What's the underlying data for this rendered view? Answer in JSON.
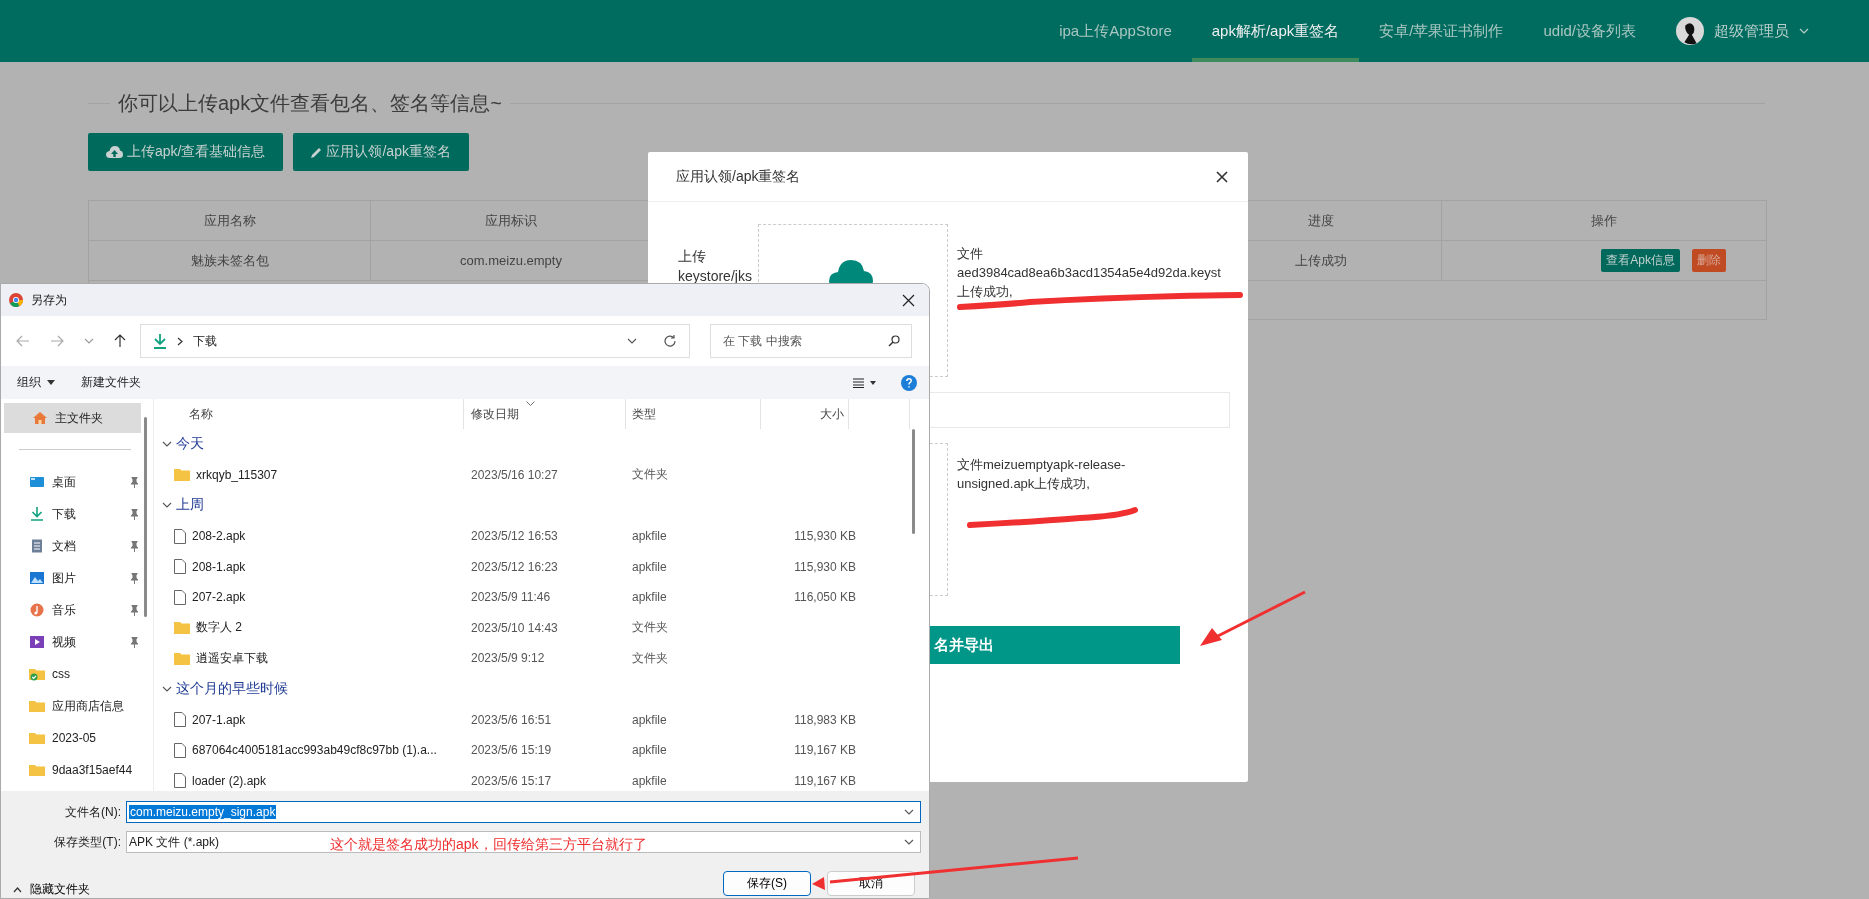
{
  "nav": {
    "items": [
      {
        "label": "ipa上传AppStore",
        "selected": false
      },
      {
        "label": "apk解析/apk重签名",
        "selected": true
      },
      {
        "label": "安卓/苹果证书制作",
        "selected": false
      },
      {
        "label": "udid/设备列表",
        "selected": false
      }
    ],
    "user": "超级管理员"
  },
  "page": {
    "heading": "你可以上传apk文件查看包名、签名等信息~",
    "buttons": [
      {
        "label": "上传apk/查看基础信息"
      },
      {
        "label": "应用认领/apk重签名"
      }
    ],
    "table": {
      "columns": [
        "应用名称",
        "应用标识",
        "进度",
        "操作"
      ],
      "rows": [
        {
          "name": "魅族未签名包",
          "id": "com.meizu.empty",
          "progress": "上传成功",
          "actions": [
            {
              "label": "查看Apk信息",
              "kind": "primary"
            },
            {
              "label": "删除",
              "kind": "danger"
            }
          ]
        }
      ]
    }
  },
  "modal": {
    "title": "应用认领/apk重签名",
    "upload_label": "上传 keystore/jks",
    "uploads": [
      {
        "message": "文件 aed3984cad8ea6b3acd1354a5e4d92da.keyst 上传成功,"
      },
      {
        "message": "文件meizuemptyapk-release-unsigned.apk上传成功,"
      }
    ],
    "submit": "名并导出"
  },
  "save_dialog": {
    "title": "另存为",
    "path": "下载",
    "search_placeholder": "在 下载 中搜索",
    "toolbar": [
      "组织",
      "新建文件夹"
    ],
    "nav_pane": [
      {
        "label": "主文件夹",
        "kind": "home",
        "selected": true,
        "pinned": false
      },
      {
        "label": "桌面",
        "kind": "desktop",
        "selected": false,
        "pinned": true
      },
      {
        "label": "下载",
        "kind": "download",
        "selected": false,
        "pinned": true
      },
      {
        "label": "文档",
        "kind": "document",
        "selected": false,
        "pinned": true
      },
      {
        "label": "图片",
        "kind": "picture",
        "selected": false,
        "pinned": true
      },
      {
        "label": "音乐",
        "kind": "music",
        "selected": false,
        "pinned": true
      },
      {
        "label": "视频",
        "kind": "video",
        "selected": false,
        "pinned": true
      },
      {
        "label": "css",
        "kind": "folder-check",
        "selected": false,
        "pinned": false
      },
      {
        "label": "应用商店信息",
        "kind": "folder",
        "selected": false,
        "pinned": false
      },
      {
        "label": "2023-05",
        "kind": "folder",
        "selected": false,
        "pinned": false
      },
      {
        "label": "9daa3f15aef44",
        "kind": "folder",
        "selected": false,
        "pinned": false
      }
    ],
    "columns": [
      {
        "label": "名称",
        "sorted": false
      },
      {
        "label": "修改日期",
        "sorted": true
      },
      {
        "label": "类型",
        "sorted": false
      },
      {
        "label": "大小",
        "sorted": false
      }
    ],
    "groups": [
      {
        "label": "今天",
        "expanded": true,
        "files": [
          {
            "name": "xrkqyb_115307",
            "kind": "folder",
            "date": "2023/5/16 10:27",
            "type": "文件夹"
          }
        ]
      },
      {
        "label": "上周",
        "expanded": true,
        "files": [
          {
            "name": "208-2.apk",
            "kind": "file",
            "date": "2023/5/12 16:53",
            "type": "apkfile",
            "size": "115,930 KB"
          },
          {
            "name": "208-1.apk",
            "kind": "file",
            "date": "2023/5/12 16:23",
            "type": "apkfile",
            "size": "115,930 KB"
          },
          {
            "name": "207-2.apk",
            "kind": "file",
            "date": "2023/5/9 11:46",
            "type": "apkfile",
            "size": "116,050 KB"
          },
          {
            "name": "数字人 2",
            "kind": "folder",
            "date": "2023/5/10 14:43",
            "type": "文件夹"
          },
          {
            "name": "逍遥安卓下载",
            "kind": "folder",
            "date": "2023/5/9 9:12",
            "type": "文件夹"
          }
        ]
      },
      {
        "label": "这个月的早些时候",
        "expanded": true,
        "files": [
          {
            "name": "207-1.apk",
            "kind": "file",
            "date": "2023/5/6 16:51",
            "type": "apkfile",
            "size": "118,983 KB"
          },
          {
            "name": "687064c4005181acc993ab49cf8c97bb (1).a...",
            "kind": "file",
            "date": "2023/5/6 15:19",
            "type": "apkfile",
            "size": "119,167 KB"
          },
          {
            "name": "loader (2).apk",
            "kind": "file",
            "date": "2023/5/6 15:17",
            "type": "apkfile",
            "size": "119,167 KB"
          }
        ]
      }
    ],
    "file_name_label": "文件名(N):",
    "file_name": "com.meizu.empty_sign.apk",
    "file_type_label": "保存类型(T):",
    "file_type": "APK 文件 (*.apk)",
    "hide_folders": "隐藏文件夹",
    "buttons": [
      {
        "label": "保存(S)",
        "kind": "primary"
      },
      {
        "label": "取消",
        "kind": "secondary"
      }
    ]
  },
  "annotation": {
    "note": "这个就是签名成功的apk，回传给第三方平台就行了"
  }
}
